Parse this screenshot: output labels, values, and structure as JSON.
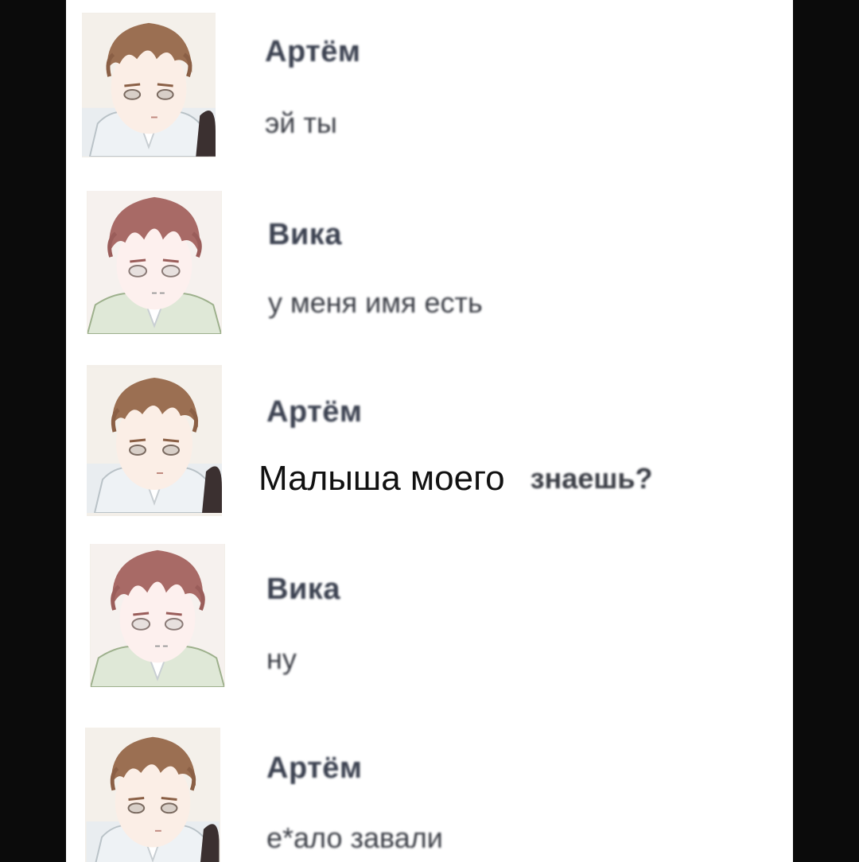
{
  "chat": {
    "messages": [
      {
        "sender": "Артём",
        "text": "эй ты"
      },
      {
        "sender": "Вика",
        "text": "у меня имя есть"
      },
      {
        "sender": "Артём",
        "overlay_text": "Малыша моего",
        "text_rest": "знаешь?"
      },
      {
        "sender": "Вика",
        "text": "ну"
      },
      {
        "sender": "Артём",
        "text": "е*ало завали"
      }
    ]
  },
  "colors": {
    "background": "#0b0b0b",
    "sheet": "#ffffff",
    "name_text": "#3b4150",
    "message_text": "#3a3d45",
    "hair_artem": "#9b6f52",
    "hair_vika": "#a86a66"
  },
  "icons": {
    "avatar_artem": "avatar-artem-icon",
    "avatar_vika": "avatar-vika-icon"
  }
}
